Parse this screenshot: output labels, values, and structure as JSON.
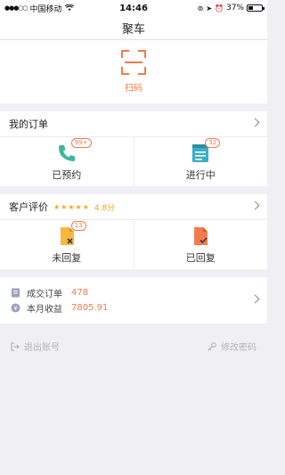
{
  "statusbar": {
    "carrier": "中国移动",
    "time": "14:46",
    "battery_level": 37,
    "battery_text": "37%"
  },
  "nav": {
    "title": "聚车"
  },
  "scan": {
    "label": "扫码"
  },
  "orders": {
    "title": "我的订单",
    "items": [
      {
        "label": "已预约",
        "badge": "99+",
        "icon": "phone-icon"
      },
      {
        "label": "进行中",
        "badge": "32",
        "icon": "notepad-icon"
      }
    ]
  },
  "reviews": {
    "title": "客户评价",
    "stars": "★★★★★",
    "rating": "4.8分",
    "items": [
      {
        "label": "未回复",
        "badge": "13",
        "icon": "document-x-icon"
      },
      {
        "label": "已回复",
        "badge": "",
        "icon": "document-check-icon"
      }
    ]
  },
  "stats": {
    "deals_label": "成交订单",
    "deals_value": "478",
    "income_label": "本月收益",
    "income_value": "7805.91"
  },
  "footer": {
    "logout": "退出账号",
    "change_password": "修改密码"
  },
  "colors": {
    "accent": "#f47b4e",
    "green": "#3bb79b",
    "teal": "#38b0c8",
    "star": "#f5a623"
  }
}
